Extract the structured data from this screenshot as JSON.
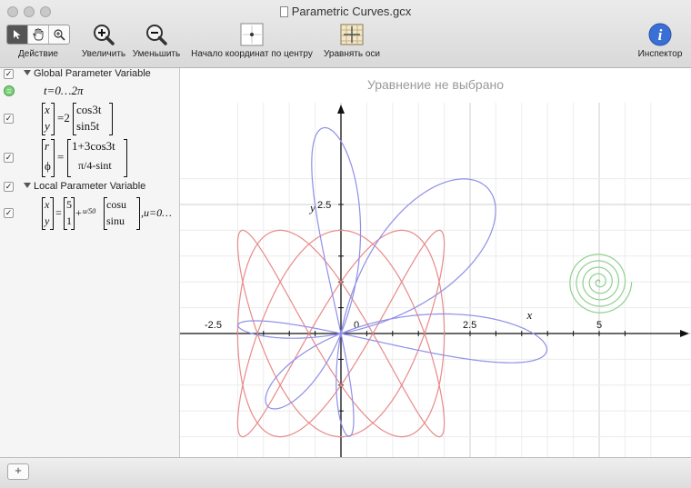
{
  "window": {
    "title": "Parametric Curves.gcx"
  },
  "toolbar": {
    "action_label": "Действие",
    "zoom_in_label": "Увеличить",
    "zoom_out_label": "Уменьшить",
    "center_origin_label": "Начало координат по центру",
    "equalize_axes_label": "Уравнять оси",
    "inspector_label": "Инспектор"
  },
  "sidebar": {
    "group1_label": "Global Parameter Variable",
    "param1": "t=0…2π",
    "eq2": {
      "lhs": [
        "x",
        "y"
      ],
      "coef": "=2",
      "rhs": [
        "cos3t",
        "sin5t"
      ]
    },
    "eq3": {
      "lhs": [
        "r",
        "ϕ"
      ],
      "rhs": [
        "1+3cos3t",
        "π/4-sint"
      ]
    },
    "group2_label": "Local Parameter Variable",
    "eq4": {
      "lhs": [
        "x",
        "y"
      ],
      "offset": [
        "5",
        "1"
      ],
      "plus": "+",
      "u_frac": "u/50",
      "rhs": [
        "cosu",
        "sinu"
      ],
      "range": ",u=0…"
    }
  },
  "graph": {
    "title": "Уравнение не выбрано",
    "axis_x_label": "x",
    "axis_y_label": "y",
    "tick_labels": [
      "-2.5",
      "0",
      "2.5",
      "5",
      "2.5"
    ]
  },
  "colors": {
    "lissajous": "#e88a8a",
    "rose": "#8f8fe8",
    "spiral": "#8fd08f",
    "accent": "#3a6fd6"
  },
  "bottombar": {
    "add_label": "+"
  }
}
